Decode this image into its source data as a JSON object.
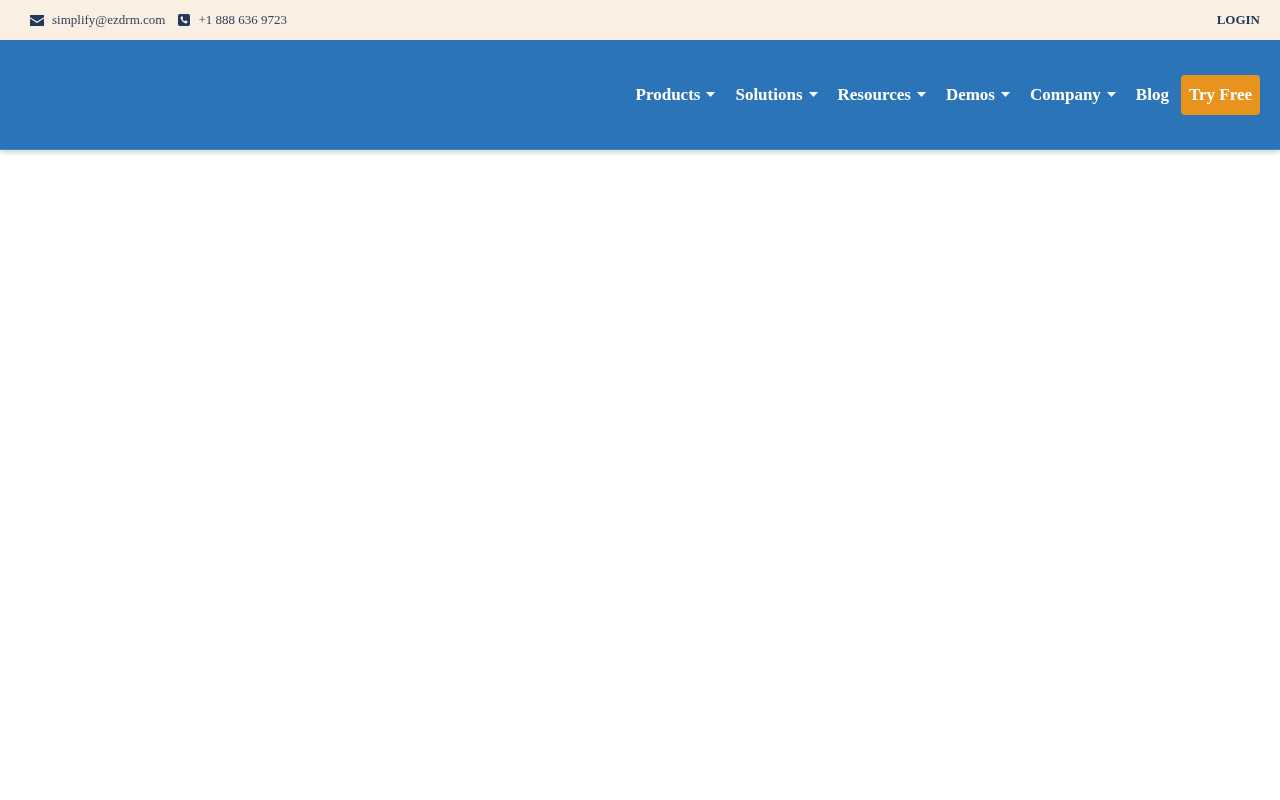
{
  "top_bar": {
    "contacts": [
      {
        "kind": "email",
        "text": "simplify@ezdrm.com"
      },
      {
        "kind": "phone",
        "text": "+1 888 636 9723"
      }
    ],
    "login": "LOGIN"
  },
  "header": {
    "nav_items": [
      {
        "label": "Products",
        "dropdown": true
      },
      {
        "label": "Solutions",
        "dropdown": true
      },
      {
        "label": "Resources",
        "dropdown": true
      },
      {
        "label": "Demos",
        "dropdown": true
      },
      {
        "label": "Company",
        "dropdown": true
      },
      {
        "label": "Blog",
        "dropdown": false
      }
    ],
    "cta": "Try Free"
  }
}
